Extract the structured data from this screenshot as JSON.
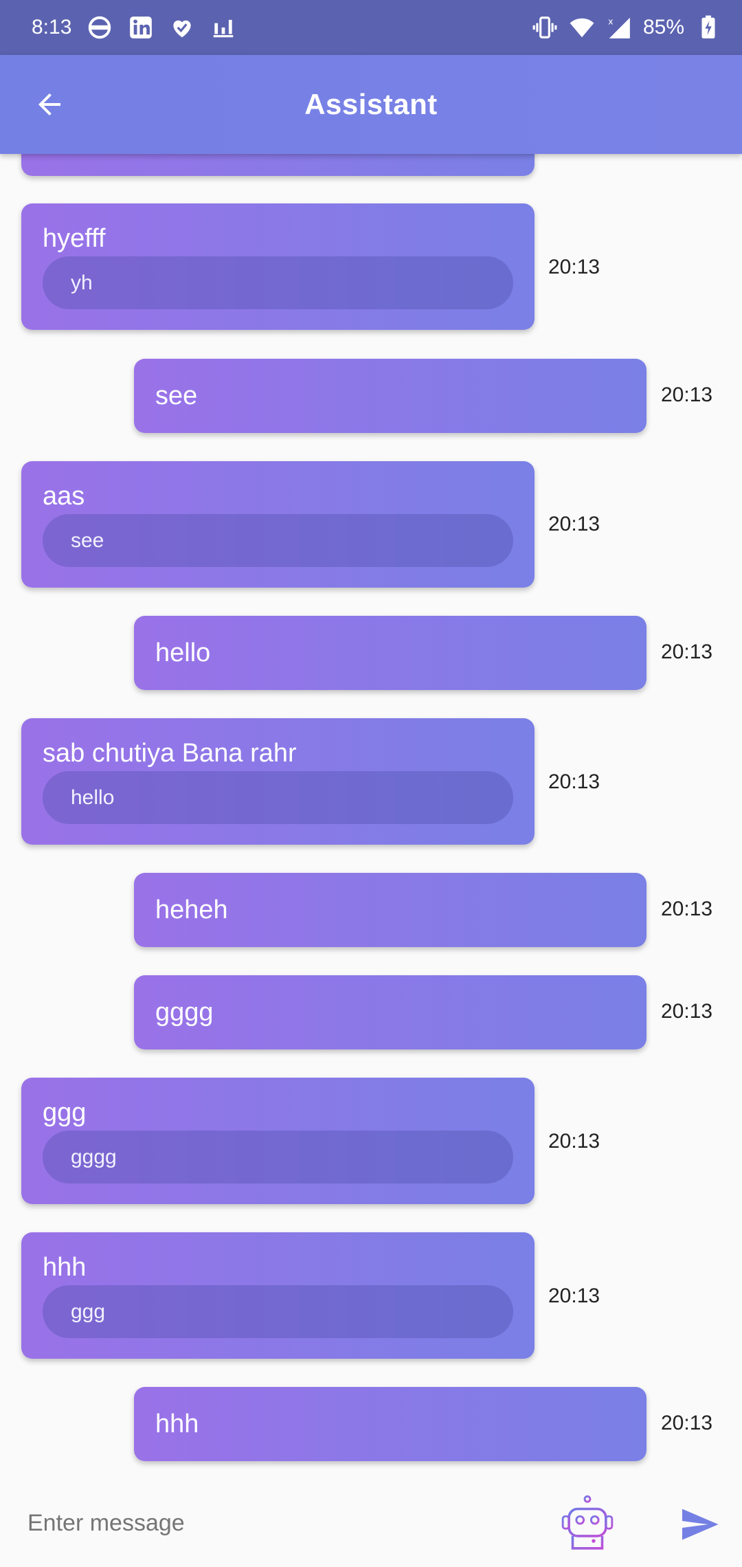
{
  "status_bar": {
    "time": "8:13",
    "battery": "85%"
  },
  "app_bar": {
    "title": "Assistant"
  },
  "input": {
    "placeholder": "Enter message"
  },
  "colors": {
    "status_bar": "#5b63b0",
    "app_bar": "#7580e4",
    "bubble_start": "#9a72e8",
    "bubble_end": "#7a80e6"
  },
  "messages": [
    {
      "type": "bot",
      "text": "hyefff",
      "reply_to": "yh",
      "time": "20:13"
    },
    {
      "type": "user",
      "text": "see",
      "time": "20:13"
    },
    {
      "type": "bot",
      "text": "aas",
      "reply_to": "see",
      "time": "20:13"
    },
    {
      "type": "user",
      "text": "hello",
      "time": "20:13"
    },
    {
      "type": "bot",
      "text": "sab chutiya Bana rahr",
      "reply_to": "hello",
      "time": "20:13"
    },
    {
      "type": "user",
      "text": "heheh",
      "time": "20:13"
    },
    {
      "type": "user",
      "text": "gggg",
      "time": "20:13"
    },
    {
      "type": "bot",
      "text": "ggg",
      "reply_to": "gggg",
      "time": "20:13"
    },
    {
      "type": "bot",
      "text": "hhh",
      "reply_to": "ggg",
      "time": "20:13"
    },
    {
      "type": "user",
      "text": "hhh",
      "time": "20:13"
    }
  ]
}
